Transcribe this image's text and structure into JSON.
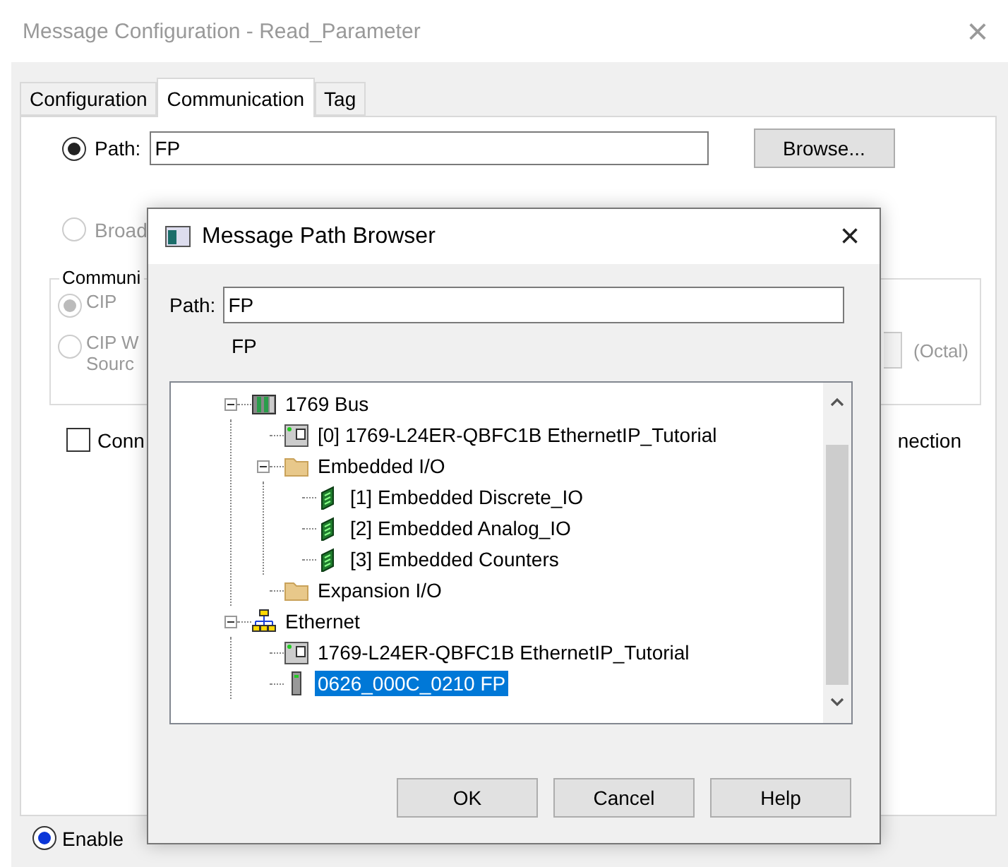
{
  "window": {
    "title": "Message Configuration - Read_Parameter",
    "close": "×"
  },
  "tabs": [
    {
      "label": "Configuration",
      "selected": false
    },
    {
      "label": "Communication",
      "selected": true
    },
    {
      "label": "Tag",
      "selected": false
    }
  ],
  "path": {
    "label": "Path:",
    "value": "FP",
    "selected": true,
    "browse": "Browse..."
  },
  "broadcast": {
    "label": "Broad",
    "selected": false,
    "disabled": true
  },
  "group": {
    "label": "Communi",
    "options": [
      {
        "label": "CIP",
        "selected": true,
        "disabled": true
      },
      {
        "label": "CIP W",
        "sublabel": "Sourc",
        "selected": false,
        "disabled": true
      }
    ],
    "octal": "(Octal)"
  },
  "connected": {
    "label": "Conn",
    "checked": false,
    "right_text": "nection"
  },
  "enable": {
    "label": "Enable",
    "selected": true
  },
  "dialog": {
    "title": "Message Path Browser",
    "close": "×",
    "path_label": "Path:",
    "path_value": "FP",
    "resolved": "FP",
    "tree": [
      {
        "label": "1769 Bus",
        "kind": "chassis",
        "expanded": true,
        "selected": false,
        "children": [
          {
            "label": "[0] 1769-L24ER-QBFC1B EthernetIP_Tutorial",
            "kind": "controller",
            "selected": false
          },
          {
            "label": "Embedded I/O",
            "kind": "folder",
            "expanded": true,
            "selected": false,
            "children": [
              {
                "label": "[1] Embedded Discrete_IO",
                "kind": "module",
                "selected": false
              },
              {
                "label": "[2] Embedded Analog_IO",
                "kind": "module",
                "selected": false
              },
              {
                "label": "[3] Embedded Counters",
                "kind": "module",
                "selected": false
              }
            ]
          },
          {
            "label": "Expansion I/O",
            "kind": "folder",
            "selected": false
          }
        ]
      },
      {
        "label": "Ethernet",
        "kind": "network",
        "expanded": true,
        "selected": false,
        "children": [
          {
            "label": "1769-L24ER-QBFC1B EthernetIP_Tutorial",
            "kind": "controller",
            "selected": false
          },
          {
            "label": "0626_000C_0210 FP",
            "kind": "device",
            "selected": true
          }
        ]
      }
    ],
    "buttons": [
      "OK",
      "Cancel",
      "Help"
    ]
  }
}
